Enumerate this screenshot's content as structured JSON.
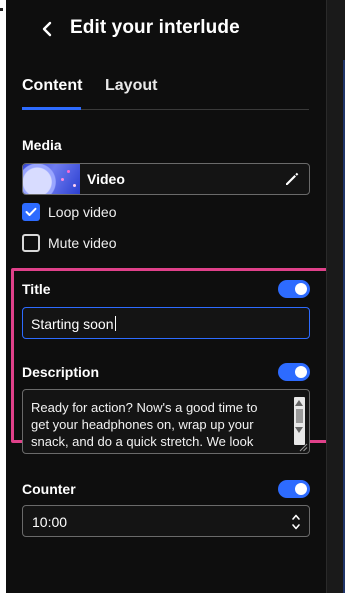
{
  "header": {
    "title": "Edit your interlude",
    "back_icon": "chevron-left-icon"
  },
  "tabs": [
    {
      "label": "Content",
      "active": true
    },
    {
      "label": "Layout",
      "active": false
    }
  ],
  "media": {
    "label": "Media",
    "type_label": "Video",
    "edit_icon": "pencil-icon"
  },
  "options": {
    "loop": {
      "label": "Loop video",
      "checked": true
    },
    "mute": {
      "label": "Mute video",
      "checked": false
    }
  },
  "title_field": {
    "label": "Title",
    "enabled": true,
    "value": "Starting soon"
  },
  "description_field": {
    "label": "Description",
    "enabled": true,
    "value": "Ready for action? Now's a good time to\nget your headphones on, wrap up your\nsnack, and do a quick stretch. We look"
  },
  "counter_field": {
    "label": "Counter",
    "enabled": true,
    "value": "10:00"
  },
  "colors": {
    "accent": "#2d6bff",
    "highlight": "#e0418a",
    "background": "#0e0e0e"
  }
}
